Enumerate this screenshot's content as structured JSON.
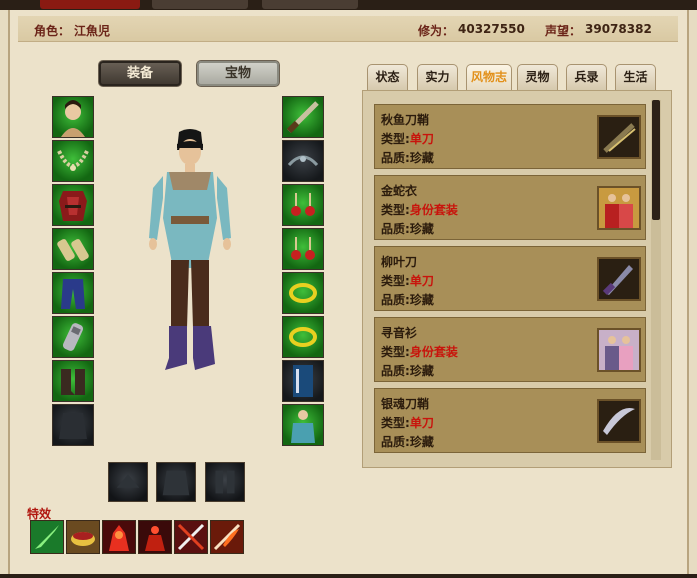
{
  "header": {
    "role_label": "角色：",
    "role_name": "江魚児",
    "cultivation_label": "修为：",
    "cultivation_value": "40327550",
    "reputation_label": "声望：",
    "reputation_value": "39078382"
  },
  "buttons": {
    "equipment": "装备",
    "treasure": "宝物"
  },
  "tabs": [
    {
      "label": "状态",
      "active": false
    },
    {
      "label": "实力",
      "active": false
    },
    {
      "label": "风物志",
      "active": true
    },
    {
      "label": "灵物",
      "active": false
    },
    {
      "label": "兵录",
      "active": false
    },
    {
      "label": "生活",
      "active": false
    }
  ],
  "cards": [
    {
      "name": "秋鱼刀鞘",
      "type_label": "类型:",
      "type_value": "单刀",
      "quality_label": "品质:",
      "quality_value": "珍藏",
      "icon": "blade-sheath-icon"
    },
    {
      "name": "金蛇衣",
      "type_label": "类型:",
      "type_value": "身份套装",
      "quality_label": "品质:",
      "quality_value": "珍藏",
      "icon": "costume-pair-icon"
    },
    {
      "name": "柳叶刀",
      "type_label": "类型:",
      "type_value": "单刀",
      "quality_label": "品质:",
      "quality_value": "珍藏",
      "icon": "willow-blade-icon"
    },
    {
      "name": "寻音衫",
      "type_label": "类型:",
      "type_value": "身份套装",
      "quality_label": "品质:",
      "quality_value": "珍藏",
      "icon": "costume-pair-icon"
    },
    {
      "name": "银魂刀鞘",
      "type_label": "类型:",
      "type_value": "单刀",
      "quality_label": "品质:",
      "quality_value": "珍藏",
      "icon": "silver-blade-icon"
    }
  ],
  "effects_label": "特效",
  "colors": {
    "accent_red": "#c8140c",
    "active_tab": "#e2901a",
    "slot_green": "#2a9a28",
    "card_bg": "#a88f58"
  }
}
